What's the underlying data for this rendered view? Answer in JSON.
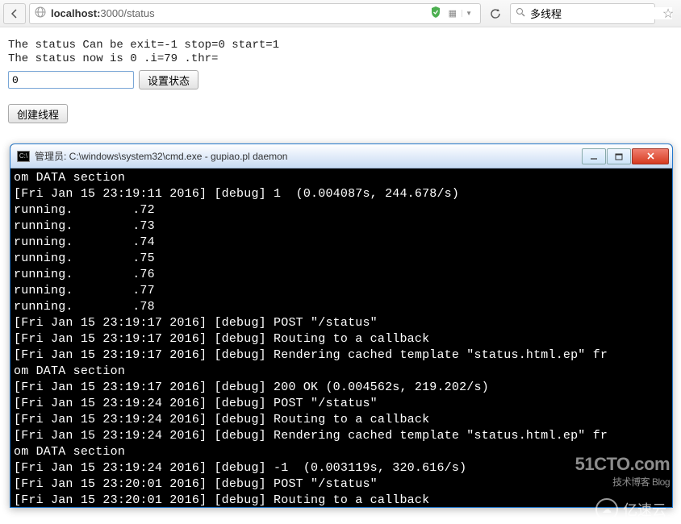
{
  "browser": {
    "url_host": "localhost:",
    "url_path": "3000/status",
    "search_value": "多线程"
  },
  "page": {
    "line1": "The status Can be exit=-1 stop=0 start=1",
    "line2": "The status now is 0 .i=79 .thr=",
    "input_value": "0",
    "btn_set_status": "设置状态",
    "btn_create_thread": "创建线程"
  },
  "cmd": {
    "title": "管理员: C:\\windows\\system32\\cmd.exe - gupiao.pl  daemon",
    "lines": [
      "om DATA section",
      "[Fri Jan 15 23:19:11 2016] [debug] 1  (0.004087s, 244.678/s)",
      "running.        .72",
      "running.        .73",
      "running.        .74",
      "running.        .75",
      "running.        .76",
      "running.        .77",
      "running.        .78",
      "[Fri Jan 15 23:19:17 2016] [debug] POST \"/status\"",
      "[Fri Jan 15 23:19:17 2016] [debug] Routing to a callback",
      "[Fri Jan 15 23:19:17 2016] [debug] Rendering cached template \"status.html.ep\" fr",
      "om DATA section",
      "[Fri Jan 15 23:19:17 2016] [debug] 200 OK (0.004562s, 219.202/s)",
      "[Fri Jan 15 23:19:24 2016] [debug] POST \"/status\"",
      "[Fri Jan 15 23:19:24 2016] [debug] Routing to a callback",
      "[Fri Jan 15 23:19:24 2016] [debug] Rendering cached template \"status.html.ep\" fr",
      "om DATA section",
      "[Fri Jan 15 23:19:24 2016] [debug] -1  (0.003119s, 320.616/s)",
      "[Fri Jan 15 23:20:01 2016] [debug] POST \"/status\"",
      "[Fri Jan 15 23:20:01 2016] [debug] Routing to a callback"
    ]
  },
  "watermark": {
    "main": "51CTO.com",
    "sub": "技术博客 Blog",
    "secondary": "亿速云"
  }
}
